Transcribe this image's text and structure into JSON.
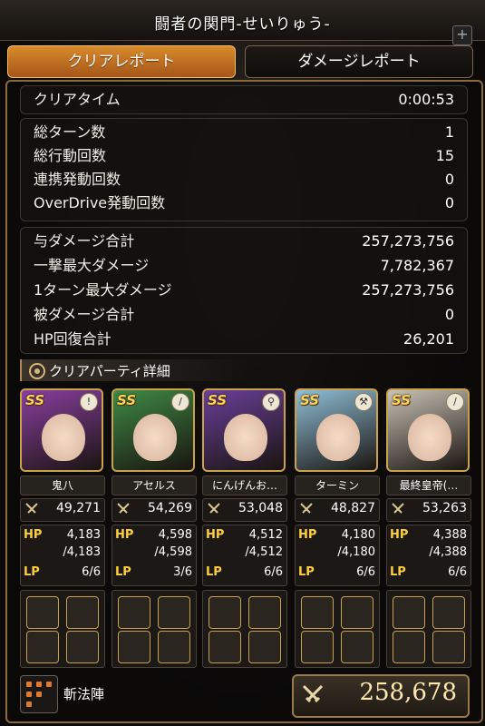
{
  "header": {
    "title": "闘者の関門-せいりゅう-",
    "plus": "+"
  },
  "tabs": {
    "clear_report": "クリアレポート",
    "damage_report": "ダメージレポート"
  },
  "time_panel": {
    "label": "クリアタイム",
    "value": "0:00:53"
  },
  "count_panel": [
    {
      "label": "総ターン数",
      "value": "1"
    },
    {
      "label": "総行動回数",
      "value": "15"
    },
    {
      "label": "連携発動回数",
      "value": "0"
    },
    {
      "label": "OverDrive発動回数",
      "value": "0"
    }
  ],
  "damage_panel": [
    {
      "label": "与ダメージ合計",
      "value": "257,273,756"
    },
    {
      "label": "一撃最大ダメージ",
      "value": "7,782,367"
    },
    {
      "label": "1ターン最大ダメージ",
      "value": "257,273,756"
    },
    {
      "label": "被ダメージ合計",
      "value": "0"
    },
    {
      "label": "HP回復合計",
      "value": "26,201"
    }
  ],
  "party_section": {
    "title": "クリアパーティ詳細"
  },
  "party": [
    {
      "rank": "SS",
      "name": "鬼八",
      "power": "49,271",
      "hp_label": "HP",
      "hp": "4,183",
      "hp_max": "/4,183",
      "lp_label": "LP",
      "lp": "6/6",
      "weapon_icon": "bow-icon",
      "color": "#8a3fa0"
    },
    {
      "rank": "SS",
      "name": "アセルス",
      "power": "54,269",
      "hp_label": "HP",
      "hp": "4,598",
      "hp_max": "/4,598",
      "lp_label": "LP",
      "lp": "3/6",
      "weapon_icon": "sword-icon",
      "color": "#3f8a45"
    },
    {
      "rank": "SS",
      "name": "にんげんお…",
      "power": "53,048",
      "hp_label": "HP",
      "hp": "4,512",
      "hp_max": "/4,512",
      "lp_label": "LP",
      "lp": "6/6",
      "weapon_icon": "staff-icon",
      "color": "#6a3f9a"
    },
    {
      "rank": "SS",
      "name": "ターミン",
      "power": "48,827",
      "hp_label": "HP",
      "hp": "4,180",
      "hp_max": "/4,180",
      "lp_label": "LP",
      "lp": "6/6",
      "weapon_icon": "axe-icon",
      "color": "#8fbfd8"
    },
    {
      "rank": "SS",
      "name": "最終皇帝(…",
      "power": "53,263",
      "hp_label": "HP",
      "hp": "4,388",
      "hp_max": "/4,388",
      "lp_label": "LP",
      "lp": "6/6",
      "weapon_icon": "sword-icon",
      "color": "#c9c2b6"
    }
  ],
  "formation": {
    "name": "斬法陣",
    "icon": "formation-icon"
  },
  "total_power": {
    "value": "258,678"
  },
  "colors": {
    "accent": "#d88a2a",
    "gold": "#c9a24b",
    "stat_label": "#ffcf3a"
  }
}
